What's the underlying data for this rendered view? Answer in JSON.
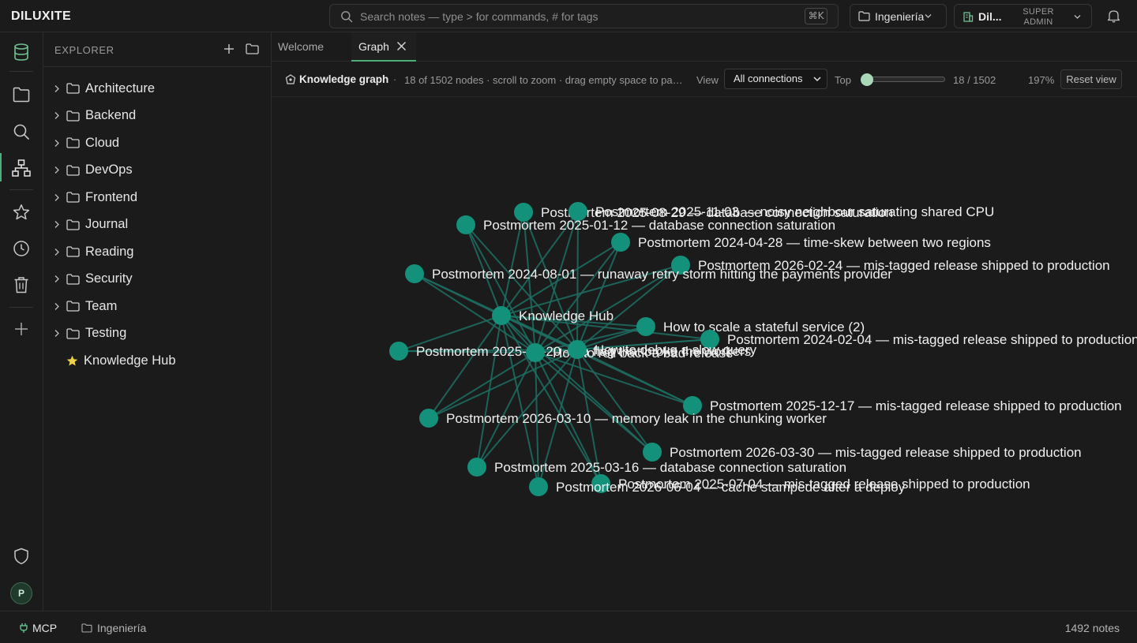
{
  "app": {
    "name": "DILUXITE"
  },
  "search": {
    "placeholder": "Search notes — type > for commands, # for tags",
    "shortcut": "⌘K"
  },
  "workspace": {
    "name": "Ingeniería"
  },
  "user": {
    "name": "Dil...",
    "role_line1": "SUPER",
    "role_line2": "ADMIN"
  },
  "explorer": {
    "title": "EXPLORER",
    "items": [
      {
        "label": "Architecture",
        "type": "folder"
      },
      {
        "label": "Backend",
        "type": "folder"
      },
      {
        "label": "Cloud",
        "type": "folder"
      },
      {
        "label": "DevOps",
        "type": "folder"
      },
      {
        "label": "Frontend",
        "type": "folder"
      },
      {
        "label": "Journal",
        "type": "folder"
      },
      {
        "label": "Reading",
        "type": "folder"
      },
      {
        "label": "Security",
        "type": "folder"
      },
      {
        "label": "Team",
        "type": "folder"
      },
      {
        "label": "Testing",
        "type": "folder"
      },
      {
        "label": "Knowledge Hub",
        "type": "starred-note"
      }
    ]
  },
  "tabs": [
    {
      "label": "Welcome",
      "active": false
    },
    {
      "label": "Graph",
      "active": true
    }
  ],
  "graph_toolbar": {
    "title": "Knowledge graph",
    "separator": "·",
    "hint": "18 of 1502 nodes · scroll to zoom · drag empty space to pan · drag a node to move it",
    "view_label": "View",
    "view_value": "All connections",
    "top_label": "Top",
    "slider_fraction": 0,
    "count": "18 / 1502",
    "zoom": "197%",
    "reset_label": "Reset view"
  },
  "graph": {
    "node_color": "#14917a",
    "edge_color": "#1d6f63",
    "hub": "Knowledge Hub",
    "nodes": [
      {
        "label": "Postmortem 2025-08-29 — database connection saturation"
      },
      {
        "label": "Postmortem 2025-11-03 — noisy neighbour saturating shared CPU"
      },
      {
        "label": "Postmortem 2025-01-12 — database connection saturation"
      },
      {
        "label": "Postmortem 2024-04-28 — time-skew between two regions"
      },
      {
        "label": "Postmortem 2026-02-24 — mis-tagged release shipped to production"
      },
      {
        "label": "Postmortem 2024-08-01 — runaway retry storm hitting the payments provider"
      },
      {
        "label": "Knowledge Hub"
      },
      {
        "label": "How to scale a stateful service (2)"
      },
      {
        "label": "Postmortem 2024-02-04 — mis-tagged release shipped to production"
      },
      {
        "label": "Postmortem 2025-01-20 — a flag that broke the workers"
      },
      {
        "label": "How to roll back a bad release"
      },
      {
        "label": "How to debug a slow query"
      },
      {
        "label": "Postmortem 2025-12-17 — mis-tagged release shipped to production"
      },
      {
        "label": "Postmortem 2026-03-10 — memory leak in the chunking worker"
      },
      {
        "label": "Postmortem 2026-03-30 — mis-tagged release shipped to production"
      },
      {
        "label": "Postmortem 2025-03-16 — database connection saturation"
      },
      {
        "label": "Postmortem 2025-07-04 — mis-tagged release shipped to production"
      },
      {
        "label": "Postmortem 2026-06-04 — cache stampede after a deploy"
      }
    ]
  },
  "statusbar": {
    "mcp": "MCP",
    "workspace": "Ingeniería",
    "notes": "1492 notes"
  },
  "colors": {
    "accent": "#4caf7a",
    "background": "#1b1b1b",
    "border": "#2c2c2c"
  }
}
